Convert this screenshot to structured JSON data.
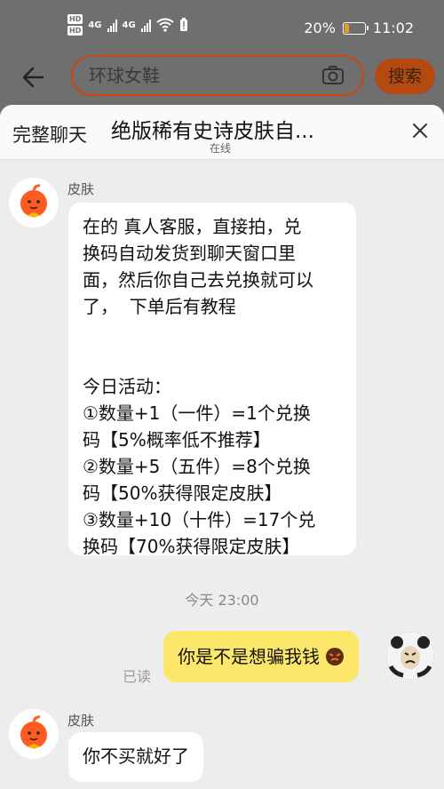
{
  "status_bar": {
    "hd1": "HD",
    "hd2": "HD",
    "net1": "4G",
    "net2": "4G",
    "battery_text": "20%",
    "battery_level": 0.2,
    "time": "11:02"
  },
  "search": {
    "query": "环球女鞋",
    "button_label": "搜索"
  },
  "chat": {
    "full_chat_label": "完整聊天",
    "title": "绝版稀有史诗皮肤自...",
    "status": "在线",
    "messages": [
      {
        "sender": "皮肤",
        "text": "在的 真人客服，直接拍，兑\n换码自动发货到聊天窗口里\n面，然后你自己去兑换就可以\n了，  下单后有教程\n\n\n今日活动：\n①数量+1（一件）=1个兑换\n码【5%概率低不推荐】\n②数量+5（五件）=8个兑换\n码【50%获得限定皮肤】\n③数量+10（十件）=17个兑\n换码【70%获得限定皮肤】"
      }
    ],
    "timestamp": "今天  23:00",
    "my_message": {
      "text": "你是不是想骗我钱",
      "read_label": "已读",
      "emoji": "angry-face-emoji"
    },
    "reply": {
      "sender": "皮肤",
      "text": "你不买就好了"
    }
  },
  "colors": {
    "accent": "#c9470f",
    "my_bubble": "#fde76a",
    "sheet_bg": "#ededed",
    "dim_bg": "#6f6f6f"
  }
}
